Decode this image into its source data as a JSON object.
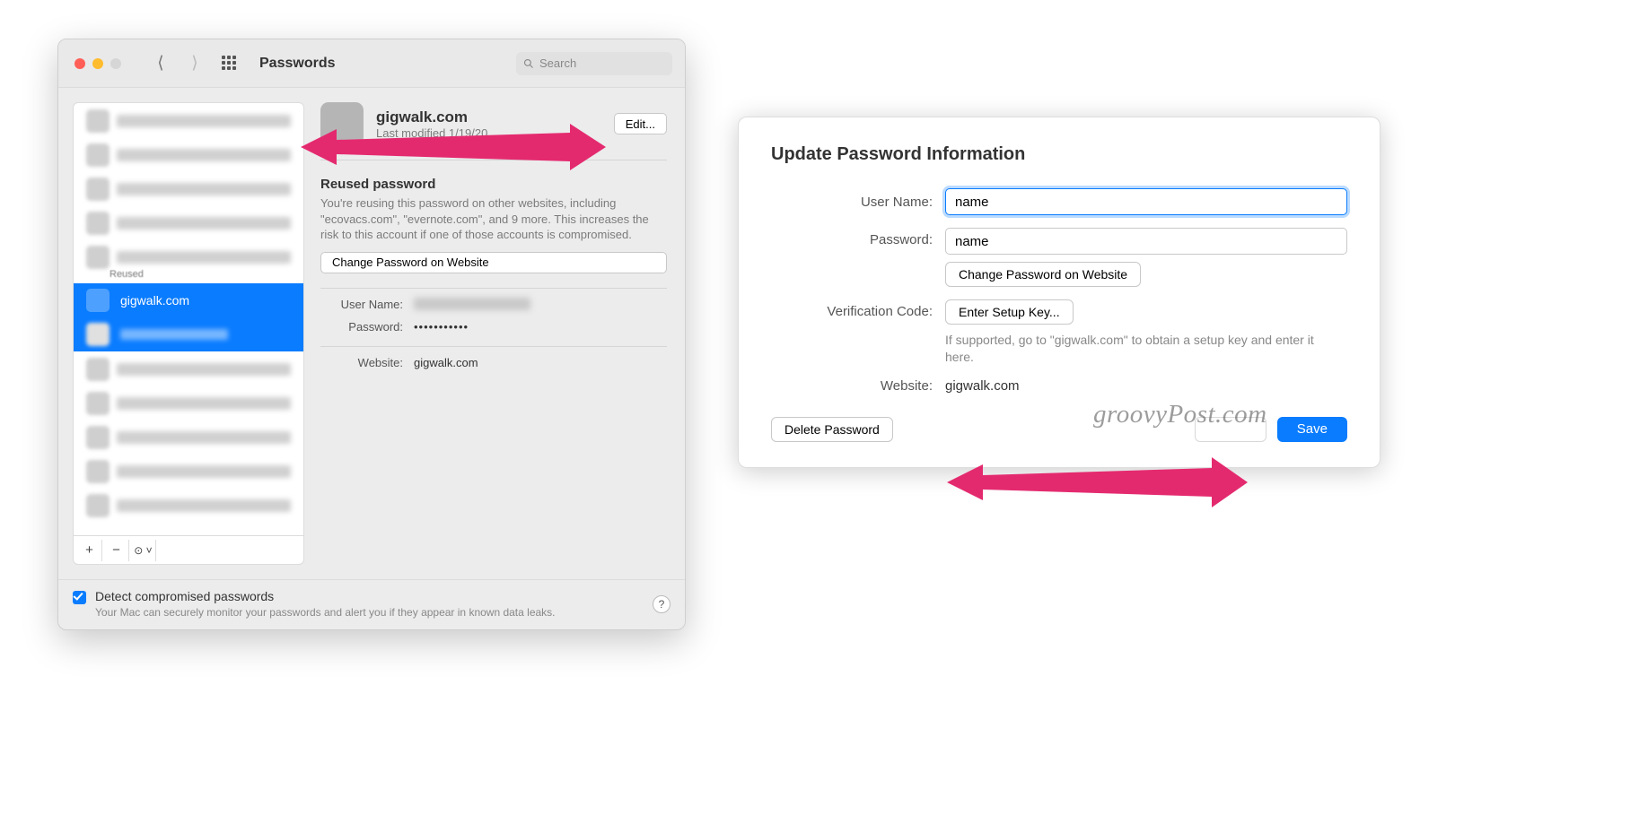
{
  "left_window": {
    "title": "Passwords",
    "search_placeholder": "Search",
    "selected_site": "gigwalk.com",
    "reused_tag": "Reused",
    "detail": {
      "site": "gigwalk.com",
      "modified": "Last modified 1/19/20",
      "edit_label": "Edit...",
      "warning_title": "Reused password",
      "warning_body": "You're reusing this password on other websites, including \"ecovacs.com\", \"evernote.com\", and 9 more. This increases the risk to this account if one of those accounts is compromised.",
      "change_btn": "Change Password on Website",
      "username_label": "User Name:",
      "password_label": "Password:",
      "password_value": "•••••••••••",
      "website_label": "Website:",
      "website_value": "gigwalk.com"
    },
    "footer": {
      "checkbox_label": "Detect compromised passwords",
      "checkbox_hint": "Your Mac can securely monitor your passwords and alert you if they appear in known data leaks."
    }
  },
  "right_window": {
    "title": "Update Password Information",
    "username_label": "User Name:",
    "username_value": "name",
    "password_label": "Password:",
    "password_value": "name",
    "change_pw_btn": "Change Password on Website",
    "verification_label": "Verification Code:",
    "setup_key_btn": "Enter Setup Key...",
    "verification_hint": "If supported, go to \"gigwalk.com\" to obtain a setup key and enter it here.",
    "website_label": "Website:",
    "website_value": "gigwalk.com",
    "delete_btn": "Delete Password",
    "save_btn": "Save"
  },
  "watermark": "groovyPost.com"
}
